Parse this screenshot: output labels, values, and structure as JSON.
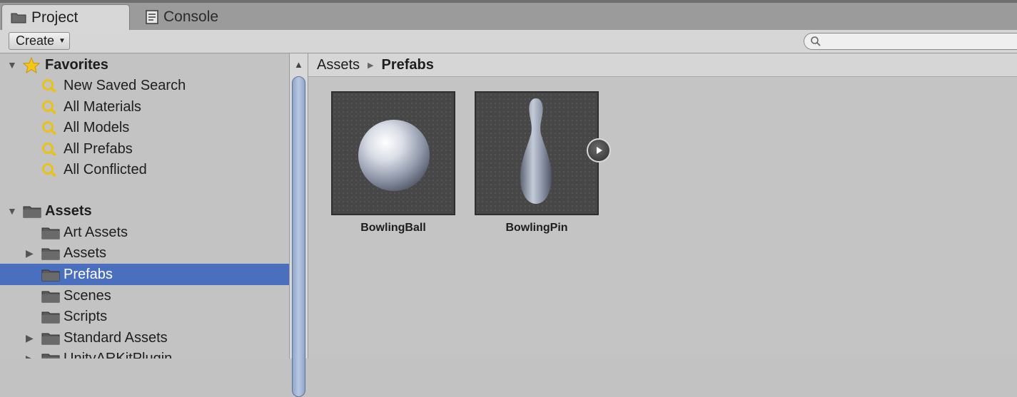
{
  "tabs": [
    {
      "label": "Project",
      "icon": "folder-icon",
      "active": true
    },
    {
      "label": "Console",
      "icon": "console-icon",
      "active": false
    }
  ],
  "toolbar": {
    "create_label": "Create",
    "search_placeholder": ""
  },
  "tree": {
    "favorites": {
      "label": "Favorites",
      "items": [
        "New Saved Search",
        "All Materials",
        "All Models",
        "All Prefabs",
        "All Conflicted"
      ]
    },
    "assets": {
      "label": "Assets",
      "items": [
        {
          "label": "Art Assets",
          "expandable": false
        },
        {
          "label": "Assets",
          "expandable": true
        },
        {
          "label": "Prefabs",
          "expandable": false,
          "selected": true
        },
        {
          "label": "Scenes",
          "expandable": false
        },
        {
          "label": "Scripts",
          "expandable": false
        },
        {
          "label": "Standard Assets",
          "expandable": true
        },
        {
          "label": "UnityARKitPlugin",
          "expandable": true
        }
      ]
    }
  },
  "breadcrumb": [
    "Assets",
    "Prefabs"
  ],
  "assets_grid": [
    {
      "name": "BowlingBall",
      "preview": "sphere"
    },
    {
      "name": "BowlingPin",
      "preview": "bowling-pin"
    }
  ],
  "colors": {
    "selection": "#4a6fbf",
    "favorite_search_icon": "#e8c21a",
    "star": "#f5c518"
  }
}
